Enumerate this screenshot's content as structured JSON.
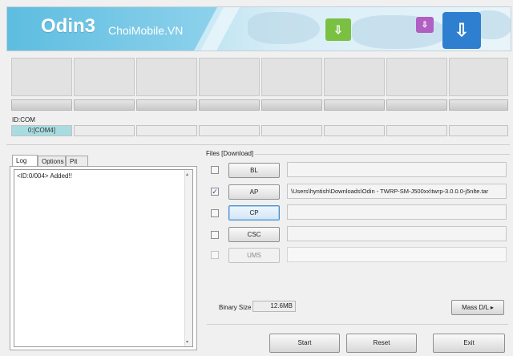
{
  "banner": {
    "title": "Odin3",
    "subtitle": "ChoiMobile.VN"
  },
  "ports": {
    "id_com_label": "ID:COM",
    "active_com": "0:[COM4]"
  },
  "log": {
    "tabs": [
      "Log",
      "Options",
      "Pit"
    ],
    "lines": [
      "<ID:0/004> Added!!"
    ]
  },
  "files": {
    "group_label": "Files [Download]",
    "rows": [
      {
        "label": "BL",
        "checked": false,
        "enabled": true,
        "path": ""
      },
      {
        "label": "AP",
        "checked": true,
        "enabled": true,
        "path": "\\Users\\hyntish\\Downloads\\Odin - TWRP-SM-J500xx\\twrp-3.0.0.0-j5nlte.tar"
      },
      {
        "label": "CP",
        "checked": false,
        "enabled": true,
        "path": ""
      },
      {
        "label": "CSC",
        "checked": false,
        "enabled": true,
        "path": ""
      },
      {
        "label": "UMS",
        "checked": false,
        "enabled": false,
        "path": ""
      }
    ]
  },
  "binary": {
    "label": "Binary Size",
    "value": "12.6MB"
  },
  "buttons": {
    "mass_dl": "Mass D/L ▸",
    "start": "Start",
    "reset": "Reset",
    "exit": "Exit"
  }
}
